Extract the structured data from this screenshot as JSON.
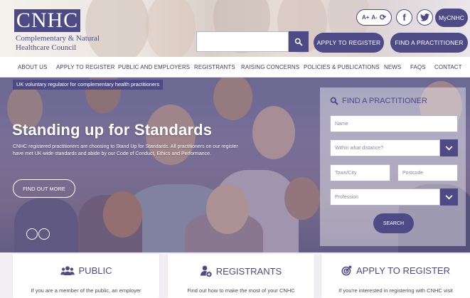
{
  "logo": {
    "mark": "CNHC",
    "line1": "Complementary & Natural",
    "line2": "Healthcare Council"
  },
  "top_controls": {
    "text_size_up": "A+",
    "text_size_down": "A-",
    "reset_symbol": "⟳",
    "facebook": "f",
    "twitter": "t",
    "my_cnhc": "MyCNHC"
  },
  "header": {
    "search_placeholder": "",
    "apply_label": "APPLY TO REGISTER",
    "find_label": "FIND A PRACTITIONER"
  },
  "nav": {
    "items": [
      "ABOUT US",
      "APPLY TO REGISTER",
      "PUBLIC AND EMPLOYERS",
      "REGISTRANTS",
      "RAISING CONCERNS",
      "POLICIES & PUBLICATIONS",
      "NEWS",
      "FAQS",
      "CONTACT"
    ]
  },
  "hero": {
    "tagline": "UK voluntary regulator for complementary health practitioners",
    "title": "Standing up for Standards",
    "text": "CNHC registered practitioners are choosing to Stand Up for Standards. All practitioners on our register have met UK-wide standards and abide by our Code of Conduct, Ethics and Performance.",
    "button": "FIND OUT MORE"
  },
  "find_practitioner": {
    "heading": "FIND A PRACTITIONER",
    "name_placeholder": "Name",
    "distance_placeholder": "Within what distance?",
    "town_placeholder": "Town/City",
    "postcode_placeholder": "Postcode",
    "profession_placeholder": "Profession",
    "search_label": "SEARCH"
  },
  "cards": {
    "public": {
      "title": "PUBLIC",
      "text": "If you are a member of the public, an employer"
    },
    "registrants": {
      "title": "REGISTRANTS",
      "text": "Find out how to make the most of your CNHC"
    },
    "apply": {
      "title": "APPLY TO REGISTER",
      "text": "If you're interested in registering with CNHC visit"
    }
  },
  "colors": {
    "brand": "#4d4a86"
  }
}
